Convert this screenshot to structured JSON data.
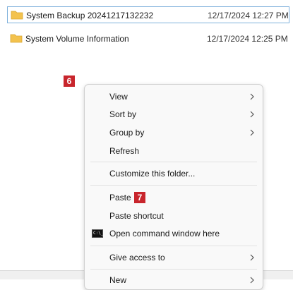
{
  "files": [
    {
      "name": "System Backup 20241217132232",
      "date": "12/17/2024 12:27 PM",
      "icon": "folder-icon",
      "selected": true
    },
    {
      "name": "System Volume Information",
      "date": "12/17/2024 12:25 PM",
      "icon": "folder-icon",
      "selected": false
    }
  ],
  "badges": {
    "step6": "6",
    "step7": "7"
  },
  "context_menu": {
    "view": "View",
    "sort_by": "Sort by",
    "group_by": "Group by",
    "refresh": "Refresh",
    "customize": "Customize this folder...",
    "paste": "Paste",
    "paste_shortcut": "Paste shortcut",
    "open_command": "Open command window here",
    "give_access": "Give access to",
    "new": "New"
  },
  "colors": {
    "badge": "#c8252c",
    "folder": "#f3c24d",
    "selection_border": "#7fb1dc"
  }
}
